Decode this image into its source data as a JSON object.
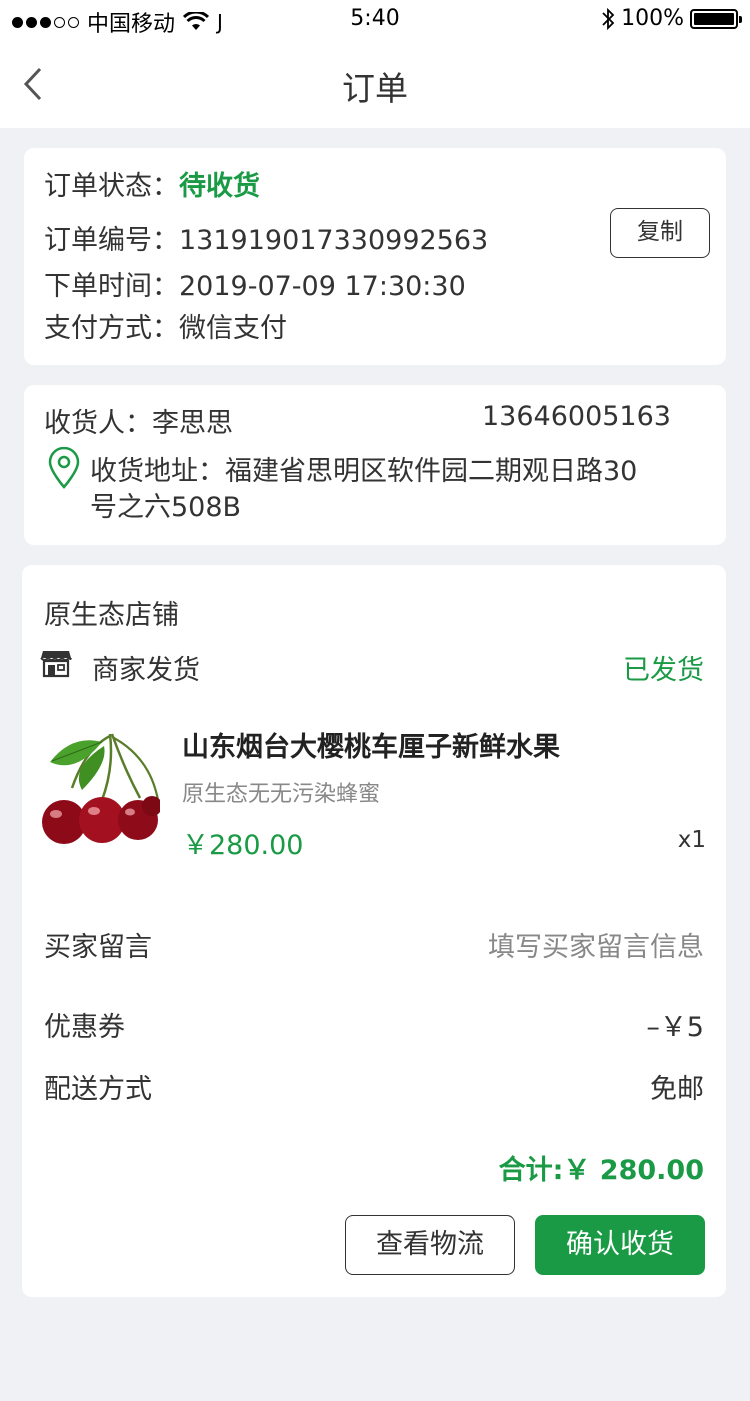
{
  "status_bar": {
    "carrier": "中国移动",
    "time": "5:40",
    "battery": "100%",
    "signal_bars": 3,
    "battery_level": 1.0
  },
  "nav": {
    "title": "订单"
  },
  "order_info": {
    "status_label": "订单状态：",
    "status_value": "待收货",
    "number_label": "订单编号：",
    "number_value": "131919017330992563",
    "copy_button": "复制",
    "time_label": "下单时间：",
    "time_value": "2019-07-09 17:30:30",
    "payment_label": "支付方式：",
    "payment_value": "微信支付"
  },
  "address": {
    "receiver_label": "收货人：",
    "receiver_name": "李思思",
    "phone": "13646005163",
    "address_label": "收货地址：",
    "address_line1": "福建省思明区软件园二期观日路30",
    "address_line2": "号之六508B"
  },
  "shop": {
    "name": "原生态店铺",
    "delivery_label": "商家发货",
    "delivery_status": "已发货",
    "product": {
      "title": "山东烟台大樱桃车厘子新鲜水果",
      "subtitle": "原生态无无污染蜂蜜",
      "price": "￥280.00",
      "quantity": "x1"
    },
    "message_label": "买家留言",
    "message_placeholder": "填写买家留言信息",
    "coupon_label": "优惠券",
    "coupon_value": "–￥5",
    "shipping_label": "配送方式",
    "shipping_value": "免邮",
    "total": "合计:￥ 280.00",
    "logistics_button": "查看物流",
    "confirm_button": "确认收货"
  },
  "colors": {
    "accent": "#1a9a45",
    "background": "#f0f1f5"
  }
}
